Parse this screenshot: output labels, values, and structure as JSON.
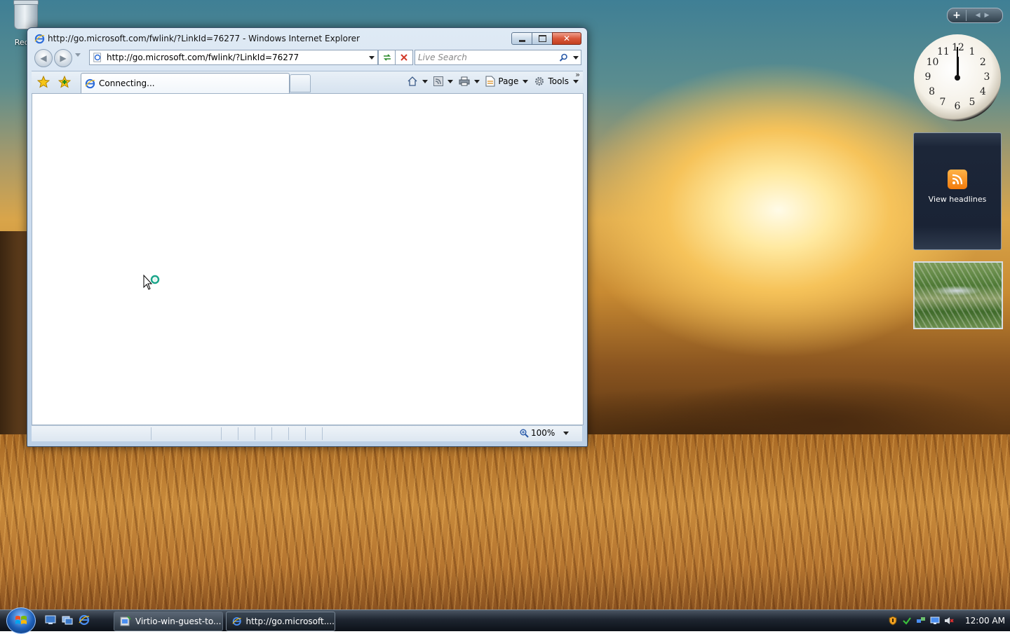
{
  "desktop": {
    "recycle_bin_label": "Recyc"
  },
  "window": {
    "title": "http://go.microsoft.com/fwlink/?LinkId=76277 - Windows Internet Explorer",
    "address_value": "http://go.microsoft.com/fwlink/?LinkId=76277",
    "search_placeholder": "Live Search",
    "tab_label": "Connecting...",
    "tools": {
      "page_label": "Page",
      "tools_label": "Tools"
    },
    "status": {
      "zoom": "100%"
    }
  },
  "gadgets": {
    "clock_numbers": [
      "12",
      "1",
      "2",
      "3",
      "4",
      "5",
      "6",
      "7",
      "8",
      "9",
      "10",
      "11"
    ],
    "feed_label": "View headlines"
  },
  "taskbar": {
    "tasks": [
      {
        "label": "Virtio-win-guest-to...",
        "icon": "setup-icon"
      },
      {
        "label": "http://go.microsoft....",
        "icon": "ie-icon"
      }
    ],
    "clock": "12:00 AM"
  },
  "colors": {
    "accent": "#1d5fb8",
    "close_button": "#d9573a",
    "rss": "#f27b0d"
  }
}
